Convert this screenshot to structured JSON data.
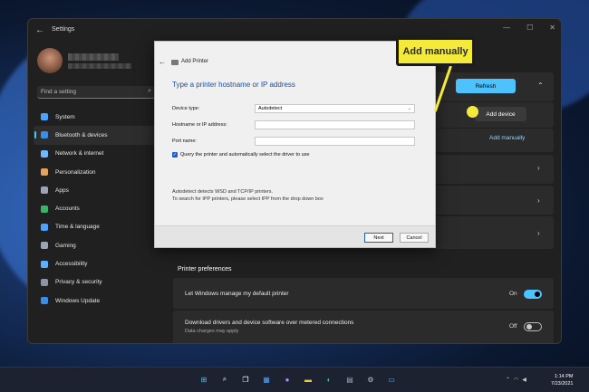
{
  "window": {
    "title": "Settings"
  },
  "search": {
    "placeholder": "Find a setting"
  },
  "nav": {
    "items": [
      {
        "label": "System",
        "icon": "monitor-icon",
        "color": "#4aa3ff"
      },
      {
        "label": "Bluetooth & devices",
        "icon": "bluetooth-icon",
        "color": "#3a8ee6"
      },
      {
        "label": "Network & internet",
        "icon": "wifi-icon",
        "color": "#6fb8ff"
      },
      {
        "label": "Personalization",
        "icon": "brush-icon",
        "color": "#e6a15a"
      },
      {
        "label": "Apps",
        "icon": "apps-icon",
        "color": "#9aa6b8"
      },
      {
        "label": "Accounts",
        "icon": "person-icon",
        "color": "#39b56a"
      },
      {
        "label": "Time & language",
        "icon": "globe-clock-icon",
        "color": "#4aa3ff"
      },
      {
        "label": "Gaming",
        "icon": "gamepad-icon",
        "color": "#9aa6b8"
      },
      {
        "label": "Accessibility",
        "icon": "accessibility-icon",
        "color": "#5ab0ff"
      },
      {
        "label": "Privacy & security",
        "icon": "shield-icon",
        "color": "#8a94a6"
      },
      {
        "label": "Windows Update",
        "icon": "update-icon",
        "color": "#3a8ee6"
      }
    ]
  },
  "main": {
    "refresh_label": "Refresh",
    "add_device_label": "Add device",
    "add_manually_label": "Add manually",
    "printer_preferences_title": "Printer preferences",
    "default_printer_label": "Let Windows manage my default printer",
    "default_printer_state": "On",
    "metered_label": "Download drivers and device software over metered connections",
    "metered_sub": "Data charges may apply",
    "metered_state": "Off"
  },
  "dialog": {
    "title": "Add Printer",
    "heading": "Type a printer hostname or IP address",
    "device_type_label": "Device type:",
    "device_type_value": "Autodetect",
    "hostname_label": "Hostname or IP address:",
    "port_label": "Port name:",
    "query_label": "Query the printer and automatically select the driver to use",
    "info_line1": "Autodetect detects WSD and TCP/IP printers.",
    "info_line2": "To search for IPP printers, please select IPP from the drop down box",
    "next_label": "Next",
    "cancel_label": "Cancel"
  },
  "callout": {
    "label": "Add manually"
  },
  "taskbar": {
    "time": "1:14 PM",
    "date": "7/23/2021",
    "icons": [
      "windows-icon",
      "search-icon",
      "task-view-icon",
      "widgets-icon",
      "chat-icon",
      "file-explorer-icon",
      "edge-icon",
      "store-icon",
      "settings-icon",
      "remote-desktop-icon"
    ]
  }
}
